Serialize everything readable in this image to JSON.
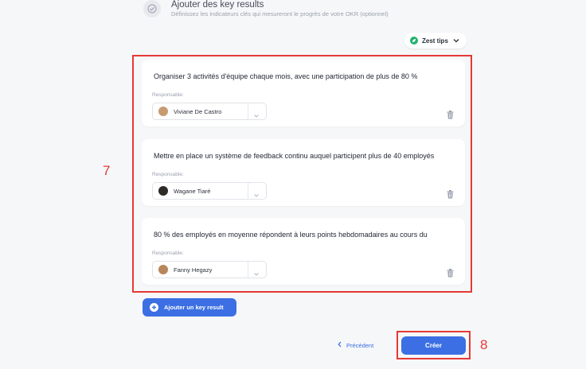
{
  "step": {
    "title": "Ajouter des key results",
    "subtitle": "Définissez les indicateurs clés qui mesureront le progrès de votre OKR (optionnel)"
  },
  "zest_tips": {
    "label": "Zest tips"
  },
  "key_results": [
    {
      "text": "Organiser 3 activités d'équipe chaque mois, avec une participation de plus de 80 %",
      "responsable_label": "Responsable:",
      "responsable": "Viviane De Castro",
      "avatar_color": "#c89a70"
    },
    {
      "text": "Mettre en place un système de feedback continu auquel participent plus de 40 employés",
      "responsable_label": "Responsable:",
      "responsable": "Wagane Tiaré",
      "avatar_color": "#2e2a28"
    },
    {
      "text": "80 % des employés en moyenne répondent à leurs points hebdomadaires au cours du",
      "responsable_label": "Responsable:",
      "responsable": "Fanny Hegazy",
      "avatar_color": "#b7865a"
    }
  ],
  "add_button": {
    "label": "Ajouter un key result"
  },
  "previous_button": {
    "label": "Précédent"
  },
  "create_button": {
    "label": "Créer"
  },
  "annotations": {
    "list_marker": "7",
    "create_marker": "8"
  },
  "colors": {
    "accent": "#3b6fe3",
    "highlight": "#e53935",
    "zest_green": "#23b26d"
  }
}
